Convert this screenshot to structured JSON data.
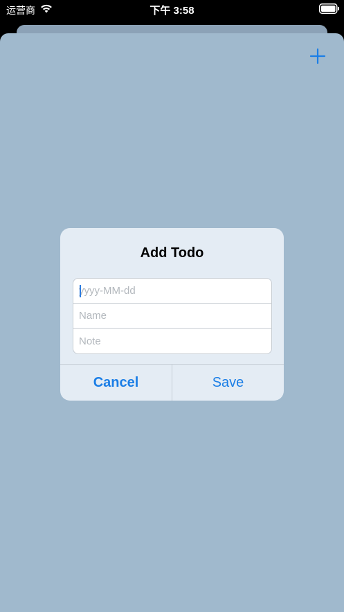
{
  "status_bar": {
    "carrier": "运营商",
    "time": "下午 3:58"
  },
  "toolbar": {
    "add_icon": "plus-icon"
  },
  "alert": {
    "title": "Add Todo",
    "fields": {
      "date_placeholder": "yyyy-MM-dd",
      "name_placeholder": "Name",
      "note_placeholder": "Note"
    },
    "buttons": {
      "cancel": "Cancel",
      "save": "Save"
    }
  },
  "colors": {
    "accent": "#1b7ee6",
    "sheet_background": "#a0b9cd",
    "alert_background": "#e4ecf4"
  }
}
